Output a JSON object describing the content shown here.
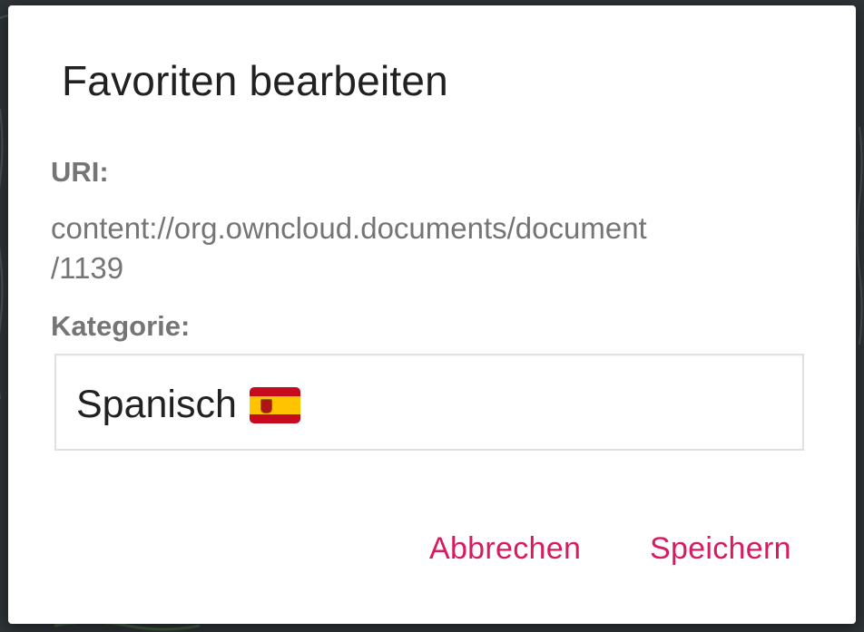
{
  "dialog": {
    "title": "Favoriten bearbeiten",
    "uri_label": "URI:",
    "uri_value_line1": "content://org.owncloud.documents/document",
    "uri_value_line2": "/1139",
    "category_label": "Kategorie:",
    "category_value": "Spanisch",
    "category_flag": "flag-spain",
    "cancel_label": "Abbrechen",
    "save_label": "Speichern"
  },
  "colors": {
    "accent": "#d81b60",
    "label_gray": "#757575",
    "title_text": "#212121",
    "backdrop": "#2e3336"
  }
}
